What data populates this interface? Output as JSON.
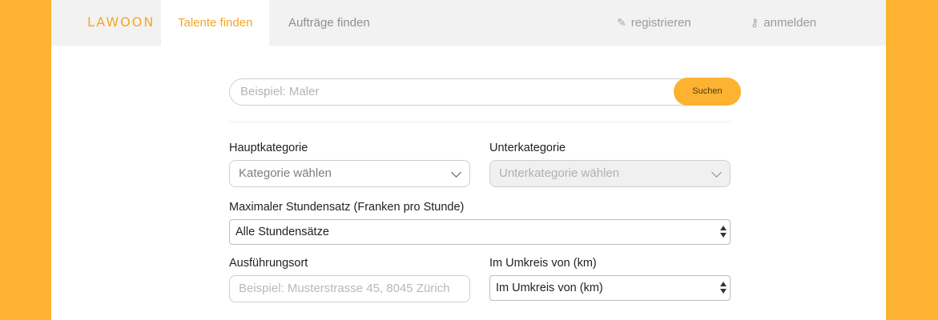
{
  "brand": {
    "logo": "LAWOON",
    "accent": "#FDB331"
  },
  "nav": {
    "tabs": [
      {
        "label": "Talente finden",
        "active": true
      },
      {
        "label": "Aufträge finden",
        "active": false
      }
    ],
    "register": {
      "label": "registrieren",
      "icon": "pencil-icon"
    },
    "login": {
      "label": "anmelden",
      "icon": "key-icon"
    }
  },
  "search": {
    "placeholder": "Beispiel: Maler",
    "button": "Suchen"
  },
  "form": {
    "main_category": {
      "label": "Hauptkategorie",
      "value": "Kategorie wählen"
    },
    "sub_category": {
      "label": "Unterkategorie",
      "value": "Unterkategorie wählen",
      "disabled": true
    },
    "rate": {
      "label": "Maximaler Stundensatz (Franken pro Stunde)",
      "value": "Alle Stundensätze"
    },
    "location": {
      "label": "Ausführungsort",
      "placeholder": "Beispiel: Musterstrasse 45, 8045 Zürich"
    },
    "radius": {
      "label": "Im Umkreis von (km)",
      "value": "Im Umkreis von (km)"
    }
  }
}
